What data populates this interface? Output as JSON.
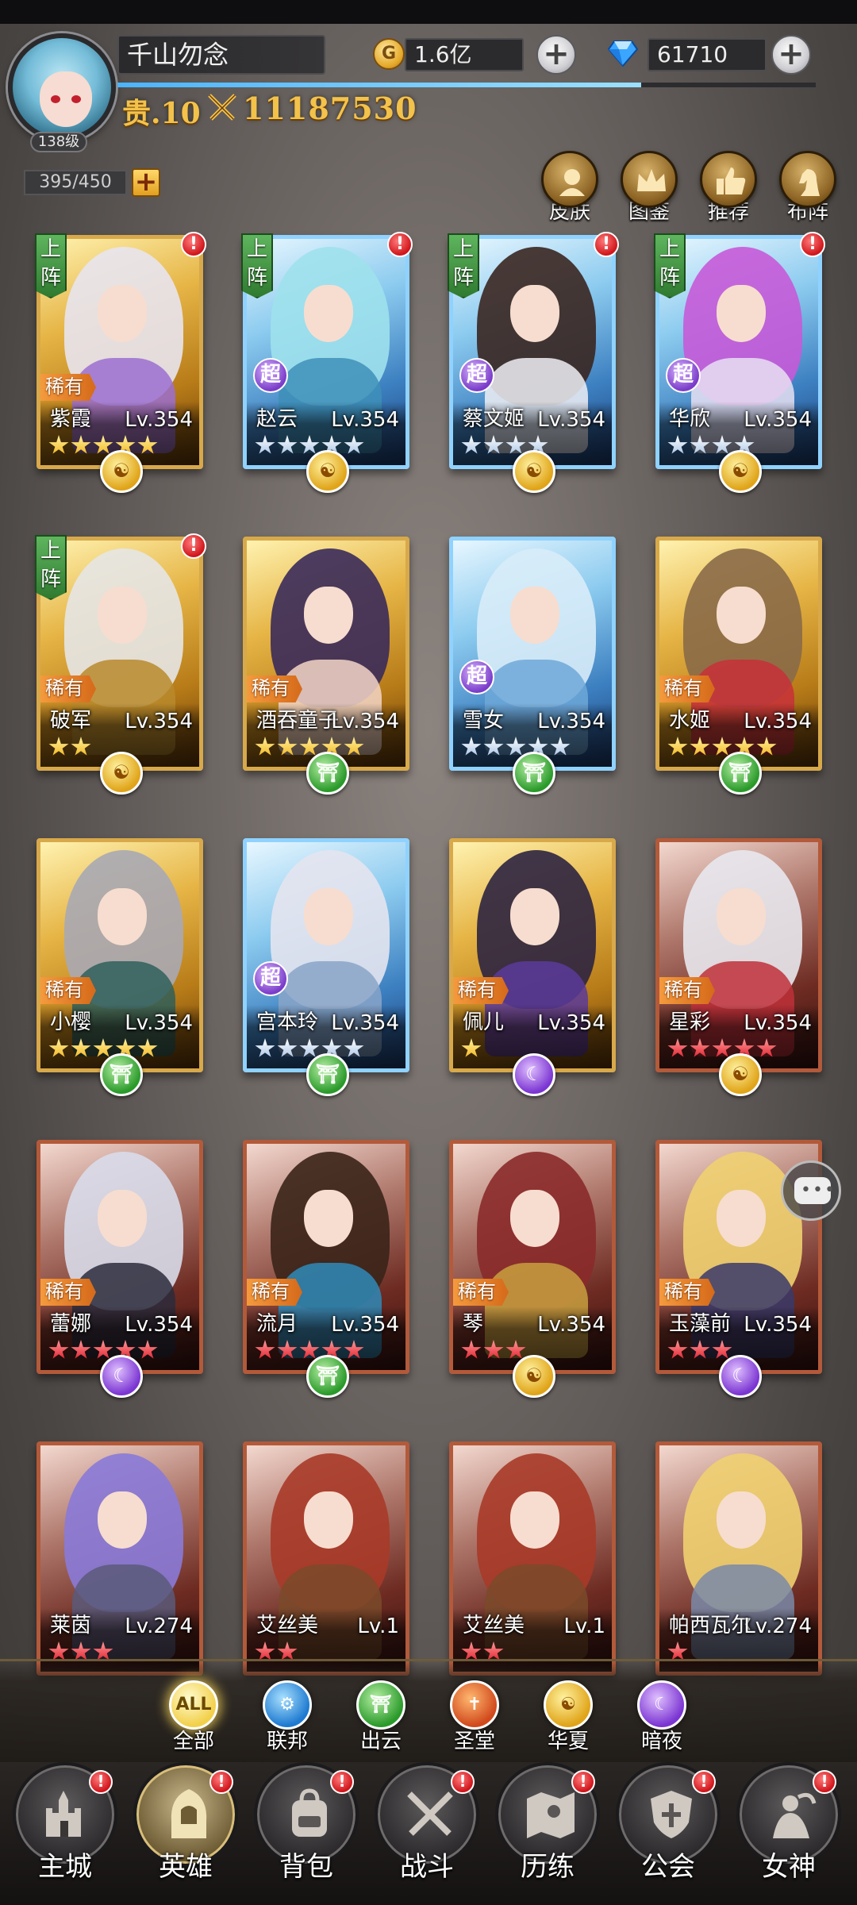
{
  "player": {
    "name": "千山勿念",
    "level_label": "138级",
    "noble_label": "贵.10",
    "power": "11187530",
    "exp_progress": 0.75
  },
  "currencies": {
    "gold": {
      "value": "1.6亿",
      "icon": "gold-coin-icon"
    },
    "gems": {
      "value": "61710",
      "icon": "diamond-icon"
    }
  },
  "capacity": "395/450",
  "top_buttons": [
    {
      "label": "皮肤",
      "icon": "skin-icon"
    },
    {
      "label": "图鉴",
      "icon": "crown-icon"
    },
    {
      "label": "推荐",
      "icon": "thumbs-up-icon"
    },
    {
      "label": "布阵",
      "icon": "chess-knight-icon"
    }
  ],
  "heroes": [
    {
      "name": "紫霞",
      "level": "Lv.354",
      "deployed_label": "上阵",
      "badge": "稀有",
      "stars": 5,
      "star_color": "gold",
      "faction": "huaxia",
      "alert": true,
      "frame": "gold",
      "hair": "#e8e4f0",
      "body": "#9b6fd0"
    },
    {
      "name": "赵云",
      "level": "Lv.354",
      "deployed_label": "上阵",
      "badge": "超",
      "stars": 5,
      "star_color": "silver",
      "faction": "huaxia",
      "alert": true,
      "frame": "blue",
      "hair": "#9ee1ec",
      "body": "#3e8fb8"
    },
    {
      "name": "蔡文姬",
      "level": "Lv.354",
      "deployed_label": "上阵",
      "badge": "超",
      "stars": 4,
      "star_color": "silver",
      "faction": "huaxia",
      "alert": true,
      "frame": "blue",
      "hair": "#3a2620",
      "body": "#f0f0f4"
    },
    {
      "name": "华欣",
      "level": "Lv.354",
      "deployed_label": "上阵",
      "badge": "超",
      "stars": 4,
      "star_color": "silver",
      "faction": "huaxia",
      "alert": true,
      "frame": "blue",
      "hair": "#c65ad8",
      "body": "#e8e0f2"
    },
    {
      "name": "破军",
      "level": "Lv.354",
      "deployed_label": "上阵",
      "badge": "稀有",
      "stars": 2,
      "star_color": "gold",
      "faction": "huaxia",
      "alert": true,
      "frame": "gold",
      "hair": "#e6e6e6",
      "body": "#b88a2c"
    },
    {
      "name": "酒吞童子",
      "level": "Lv.354",
      "deployed_label": "",
      "badge": "稀有",
      "stars": 5,
      "star_color": "gold",
      "faction": "chuyun",
      "alert": false,
      "frame": "gold",
      "hair": "#3a2a5a",
      "body": "#f3d6c8"
    },
    {
      "name": "雪女",
      "level": "Lv.354",
      "deployed_label": "",
      "badge": "超",
      "stars": 5,
      "star_color": "silver",
      "faction": "chuyun",
      "alert": false,
      "frame": "blue",
      "hair": "#d8ecf8",
      "body": "#6ea8d8"
    },
    {
      "name": "水姬",
      "level": "Lv.354",
      "deployed_label": "",
      "badge": "稀有",
      "stars": 5,
      "star_color": "gold",
      "faction": "chuyun",
      "alert": false,
      "frame": "gold",
      "hair": "#8a6a48",
      "body": "#c8303a"
    },
    {
      "name": "小樱",
      "level": "Lv.354",
      "deployed_label": "",
      "badge": "稀有",
      "stars": 5,
      "star_color": "gold",
      "faction": "chuyun",
      "alert": false,
      "frame": "gold",
      "hair": "#a8a8b4",
      "body": "#2f5f5a"
    },
    {
      "name": "宫本玲",
      "level": "Lv.354",
      "deployed_label": "",
      "badge": "超",
      "stars": 5,
      "star_color": "silver",
      "faction": "chuyun",
      "alert": false,
      "frame": "blue",
      "hair": "#e4e4ee",
      "body": "#8aa4c8"
    },
    {
      "name": "佩儿",
      "level": "Lv.354",
      "deployed_label": "",
      "badge": "稀有",
      "stars": 1,
      "star_color": "gold",
      "faction": "anye",
      "alert": false,
      "frame": "gold",
      "hair": "#2c2440",
      "body": "#5a3a9a"
    },
    {
      "name": "星彩",
      "level": "Lv.354",
      "deployed_label": "",
      "badge": "稀有",
      "stars": 5,
      "star_color": "red",
      "faction": "huaxia",
      "alert": false,
      "frame": "red",
      "hair": "#e8e8ee",
      "body": "#c0303a"
    },
    {
      "name": "蕾娜",
      "level": "Lv.354",
      "deployed_label": "",
      "badge": "稀有",
      "stars": 5,
      "star_color": "red",
      "faction": "anye",
      "alert": false,
      "frame": "red",
      "hair": "#d8dcea",
      "body": "#2c2c3c"
    },
    {
      "name": "流月",
      "level": "Lv.354",
      "deployed_label": "",
      "badge": "稀有",
      "stars": 5,
      "star_color": "red",
      "faction": "chuyun",
      "alert": false,
      "frame": "red",
      "hair": "#3a2418",
      "body": "#2f8ab8"
    },
    {
      "name": "琴",
      "level": "Lv.354",
      "deployed_label": "",
      "badge": "稀有",
      "stars": 3,
      "star_color": "red",
      "faction": "huaxia",
      "alert": false,
      "frame": "red",
      "hair": "#8a2a2a",
      "body": "#c8a040"
    },
    {
      "name": "玉藻前",
      "level": "Lv.354",
      "deployed_label": "",
      "badge": "稀有",
      "stars": 3,
      "star_color": "red",
      "faction": "anye",
      "alert": false,
      "frame": "red",
      "hair": "#f0d070",
      "body": "#3a3a6a"
    },
    {
      "name": "莱茵",
      "level": "Lv.274",
      "deployed_label": "",
      "badge": "",
      "stars": 3,
      "star_color": "red",
      "faction": "",
      "alert": false,
      "frame": "red",
      "hair": "#8a7ad8",
      "body": "#5a5a7a"
    },
    {
      "name": "艾丝美",
      "level": "Lv.1",
      "deployed_label": "",
      "badge": "",
      "stars": 2,
      "star_color": "red",
      "faction": "",
      "alert": false,
      "frame": "red",
      "hair": "#a83a28",
      "body": "#7a4a2a"
    },
    {
      "name": "艾丝美",
      "level": "Lv.1",
      "deployed_label": "",
      "badge": "",
      "stars": 2,
      "star_color": "red",
      "faction": "",
      "alert": false,
      "frame": "red",
      "hair": "#a83a28",
      "body": "#7a4a2a"
    },
    {
      "name": "帕西瓦尔",
      "level": "Lv.274",
      "deployed_label": "",
      "badge": "",
      "stars": 1,
      "star_color": "red",
      "faction": "",
      "alert": false,
      "frame": "red",
      "hair": "#f0d070",
      "body": "#7a8aa8"
    }
  ],
  "faction_filters": [
    {
      "label": "全部",
      "glyph": "ALL",
      "key": "all",
      "selected": true
    },
    {
      "label": "联邦",
      "glyph": "⚙",
      "key": "lianbang",
      "selected": false
    },
    {
      "label": "出云",
      "glyph": "⛩",
      "key": "chuyun",
      "selected": false
    },
    {
      "label": "圣堂",
      "glyph": "✝",
      "key": "shengtang",
      "selected": false
    },
    {
      "label": "华夏",
      "glyph": "☯",
      "key": "huaxia",
      "selected": false
    },
    {
      "label": "暗夜",
      "glyph": "☾",
      "key": "anye",
      "selected": false
    }
  ],
  "faction_glyphs": {
    "huaxia": "☯",
    "chuyun": "⛩",
    "anye": "☾"
  },
  "bottom_nav": [
    {
      "label": "主城",
      "icon": "castle-icon",
      "alert": true,
      "active": false
    },
    {
      "label": "英雄",
      "icon": "hooded-hero-icon",
      "alert": true,
      "active": true
    },
    {
      "label": "背包",
      "icon": "backpack-icon",
      "alert": true,
      "active": false
    },
    {
      "label": "战斗",
      "icon": "crossed-swords-icon",
      "alert": true,
      "active": false
    },
    {
      "label": "历练",
      "icon": "map-icon",
      "alert": true,
      "active": false
    },
    {
      "label": "公会",
      "icon": "guild-shield-icon",
      "alert": true,
      "active": false
    },
    {
      "label": "女神",
      "icon": "goddess-icon",
      "alert": true,
      "active": false
    }
  ],
  "alert_mark": "!"
}
